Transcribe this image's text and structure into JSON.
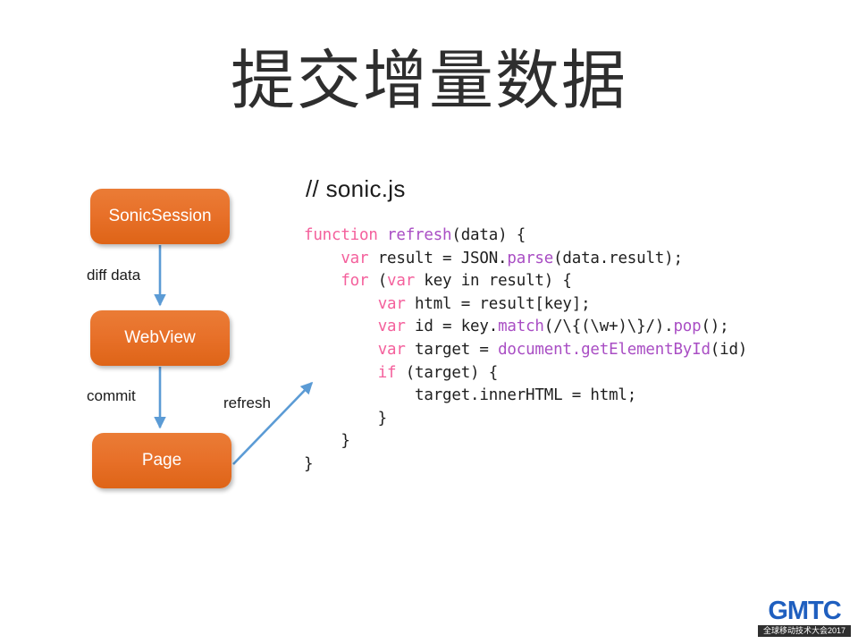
{
  "slide": {
    "title": "提交增量数据",
    "background_color": "#ffffff"
  },
  "diagram": {
    "box_color": "#e8712a",
    "arrow_color": "#5b9bd5",
    "boxes": [
      {
        "label": "SonicSession"
      },
      {
        "label": "WebView"
      },
      {
        "label": "Page"
      }
    ],
    "arrow_labels": [
      {
        "label": "diff data"
      },
      {
        "label": "commit"
      },
      {
        "label": "refresh"
      }
    ]
  },
  "code": {
    "filename_comment": "// sonic.js",
    "keyword_color": "#f4609c",
    "function_color": "#a94ec4",
    "lines": [
      [
        {
          "t": "function",
          "c": "kw"
        },
        {
          "t": " ",
          "c": ""
        },
        {
          "t": "refresh",
          "c": "fn"
        },
        {
          "t": "(data) {",
          "c": ""
        }
      ],
      [
        {
          "t": "    ",
          "c": ""
        },
        {
          "t": "var",
          "c": "kw"
        },
        {
          "t": " result = JSON.",
          "c": ""
        },
        {
          "t": "parse",
          "c": "fn"
        },
        {
          "t": "(data.result);",
          "c": ""
        }
      ],
      [
        {
          "t": "    ",
          "c": ""
        },
        {
          "t": "for",
          "c": "kw"
        },
        {
          "t": " (",
          "c": ""
        },
        {
          "t": "var",
          "c": "kw"
        },
        {
          "t": " key in result) {",
          "c": ""
        }
      ],
      [
        {
          "t": "        ",
          "c": ""
        },
        {
          "t": "var",
          "c": "kw"
        },
        {
          "t": " html = result[key];",
          "c": ""
        }
      ],
      [
        {
          "t": "        ",
          "c": ""
        },
        {
          "t": "var",
          "c": "kw"
        },
        {
          "t": " id = key.",
          "c": ""
        },
        {
          "t": "match",
          "c": "fn"
        },
        {
          "t": "(/\\{(\\w+)\\}/).",
          "c": ""
        },
        {
          "t": "pop",
          "c": "fn"
        },
        {
          "t": "();",
          "c": ""
        }
      ],
      [
        {
          "t": "        ",
          "c": ""
        },
        {
          "t": "var",
          "c": "kw"
        },
        {
          "t": " target = ",
          "c": ""
        },
        {
          "t": "document.getElementById",
          "c": "fn"
        },
        {
          "t": "(id)",
          "c": ""
        }
      ],
      [
        {
          "t": "        ",
          "c": ""
        },
        {
          "t": "if",
          "c": "kw"
        },
        {
          "t": " (target) {",
          "c": ""
        }
      ],
      [
        {
          "t": "            target.innerHTML = html;",
          "c": ""
        }
      ],
      [
        {
          "t": "        }",
          "c": ""
        }
      ],
      [
        {
          "t": "    }",
          "c": ""
        }
      ],
      [
        {
          "t": "}",
          "c": ""
        }
      ]
    ]
  },
  "logo": {
    "wordmark": "GMTC",
    "tagline": "全球移动技术大会2017",
    "brand_color": "#1f5fbf"
  }
}
